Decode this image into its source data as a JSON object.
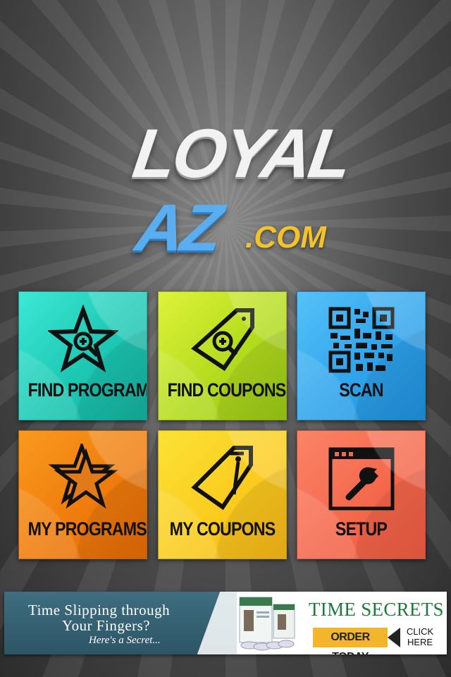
{
  "logo": {
    "line1": "LOYAL",
    "line2": "AZ",
    "suffix": ".COM",
    "colors": {
      "line1": "#f2f2f2",
      "line2": "#5aaef0",
      "suffix": "#f4c22a"
    }
  },
  "tiles": [
    {
      "label": "FIND PROGRAMS",
      "icon": "star-search-icon",
      "color": "#22cfbb"
    },
    {
      "label": "FIND COUPONS",
      "icon": "tag-search-icon",
      "color": "#c3e326"
    },
    {
      "label": "SCAN",
      "icon": "qr-code-icon",
      "color": "#3aacef"
    },
    {
      "label": "MY PROGRAMS",
      "icon": "stars-icon",
      "color": "#f08010"
    },
    {
      "label": "MY COUPONS",
      "icon": "coupons-icon",
      "color": "#fbd424"
    },
    {
      "label": "SETUP",
      "icon": "wrench-window-icon",
      "color": "#f66f52"
    }
  ],
  "ad": {
    "headline_1": "Time Slipping through",
    "headline_2": "Your Fingers?",
    "headline_3": "Here's a Secret...",
    "brand": "TIME SECRETS",
    "cta": "ORDER TODAY",
    "click_1": "CLICK",
    "click_2": "HERE",
    "product_icon": "book-cds-icon"
  }
}
